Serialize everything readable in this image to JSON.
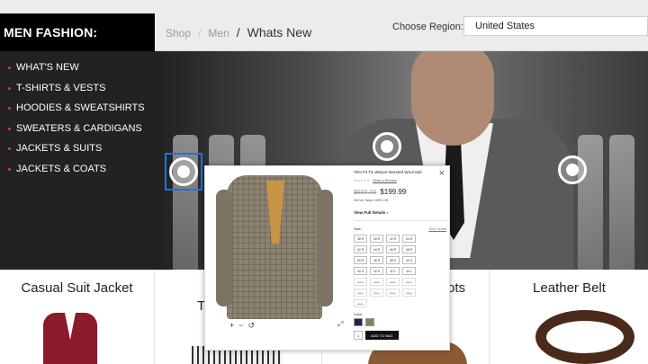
{
  "header": {
    "brand": "MEN FASHION:",
    "breadcrumb": [
      "Shop",
      "Men",
      "Whats New"
    ],
    "region_label": "Choose Region:",
    "region_value": "United States"
  },
  "sidebar": {
    "items": [
      {
        "label": "WHAT'S NEW"
      },
      {
        "label": "T-SHIRTS & VESTS"
      },
      {
        "label": "HOODIES & SWEATSHIRTS"
      },
      {
        "label": "SWEATERS & CARDIGANS"
      },
      {
        "label": "JACKETS & SUITS"
      },
      {
        "label": "JACKETS & COATS"
      }
    ]
  },
  "products": [
    {
      "title": "Casual Suit Jacket"
    },
    {
      "title": "T"
    },
    {
      "title": "ots"
    },
    {
      "title": "Leather Belt"
    }
  ],
  "quickview": {
    "close": "×",
    "title": "Trim Fit Tic Weave Worsted Wool Suit",
    "write_review": "Write a Review",
    "was_price": "$650.00",
    "now_price": "$199.99",
    "saving": "We've Taken 69% Off",
    "full_details": "View Full Details ›",
    "size_label": "Size:",
    "size_guide": "Size Guide",
    "sizes": [
      {
        "label": "38 R",
        "available": true
      },
      {
        "label": "40 R",
        "available": true
      },
      {
        "label": "42 R",
        "available": true
      },
      {
        "label": "44 R",
        "available": true
      },
      {
        "label": "42 R",
        "available": true
      },
      {
        "label": "44 R",
        "available": true
      },
      {
        "label": "46 R",
        "available": true
      },
      {
        "label": "48 R",
        "available": true
      },
      {
        "label": "50 R",
        "available": true
      },
      {
        "label": "36 S",
        "available": true
      },
      {
        "label": "38 S",
        "available": true
      },
      {
        "label": "40 S",
        "available": true
      },
      {
        "label": "40 S",
        "available": true
      },
      {
        "label": "42 S",
        "available": true
      },
      {
        "label": "42 L",
        "available": true
      },
      {
        "label": "44 L",
        "available": true
      },
      {
        "label": "44 L",
        "available": false
      },
      {
        "label": "46 L",
        "available": false
      },
      {
        "label": "48 L",
        "available": false
      },
      {
        "label": "50 L",
        "available": false
      },
      {
        "label": "40 L",
        "available": false
      },
      {
        "label": "42 L",
        "available": false
      },
      {
        "label": "44 L",
        "available": false
      },
      {
        "label": "46 L",
        "available": false
      },
      {
        "label": "46 L",
        "available": false
      }
    ],
    "color_label": "Color:",
    "swatches": [
      "#1f2440",
      "#8a7a5e"
    ],
    "quantity": "1",
    "add_to_bag": "ADD TO BAG",
    "zoom_in": "+",
    "zoom_out": "−",
    "rotate": "↺",
    "expand": "⤢"
  }
}
